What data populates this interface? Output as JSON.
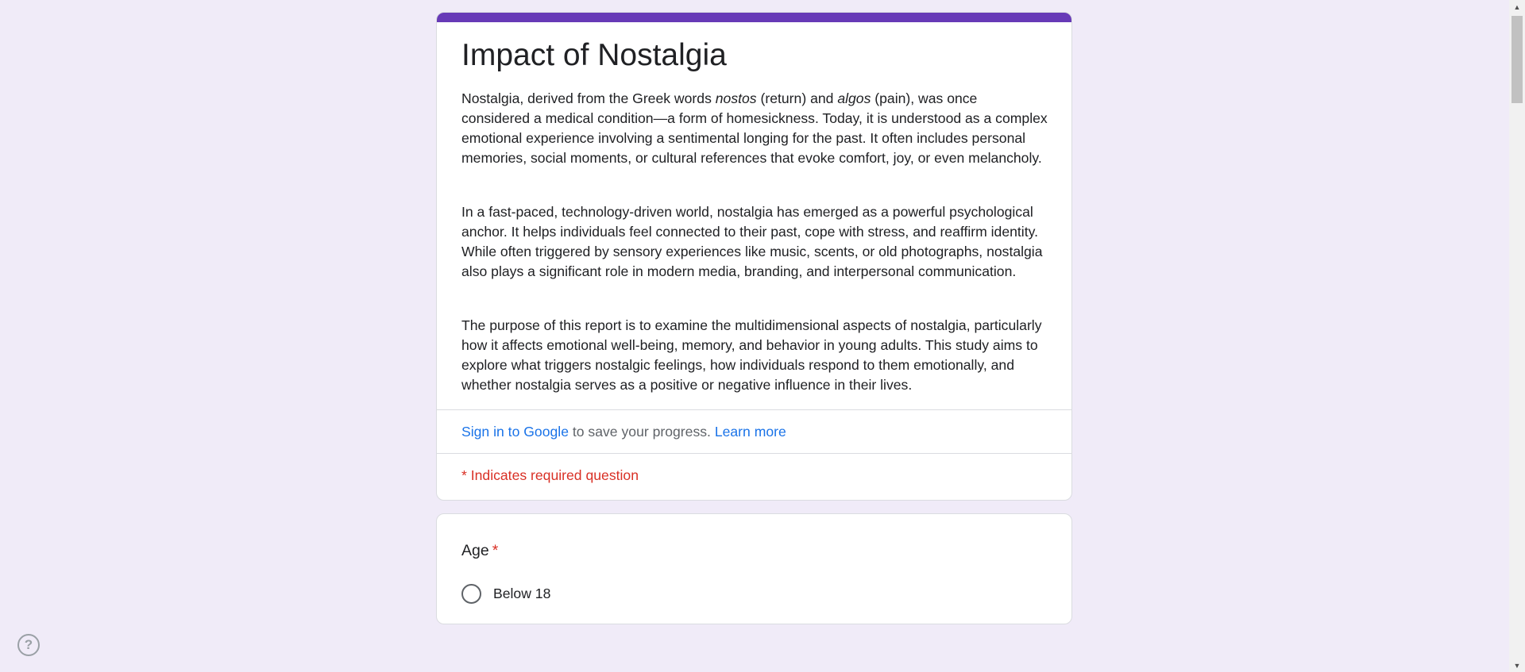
{
  "form": {
    "title": "Impact of Nostalgia",
    "accent_color": "#673ab7",
    "background_color": "#f0ebf8",
    "description": {
      "p1_before_nostos": "Nostalgia, derived from the Greek words ",
      "p1_nostos": "nostos",
      "p1_between": " (return) and ",
      "p1_algos": "algos",
      "p1_after_algos": " (pain), was once considered a medical condition—a form of homesickness. Today, it is understood as a complex emotional experience involving a sentimental longing for the past. It often includes personal memories, social moments, or cultural references that evoke comfort, joy, or even melancholy.",
      "p2": "In a fast-paced, technology-driven world, nostalgia has emerged as a powerful psychological anchor. It helps individuals feel connected to their past, cope with stress, and reaffirm identity. While often triggered by sensory experiences like music, scents, or old photographs, nostalgia also plays a significant role in modern media, branding, and interpersonal communication.",
      "p3": "The purpose of this report is to examine the multidimensional aspects of nostalgia, particularly how it affects emotional well-being, memory, and behavior in young adults. This study aims to explore what triggers nostalgic feelings, how individuals respond to them emotionally, and whether nostalgia serves as a positive or negative influence in their lives."
    },
    "signin": {
      "link_label": "Sign in to Google",
      "text": " to save your progress. ",
      "learn_more_label": "Learn more"
    },
    "required_notice": "* Indicates required question"
  },
  "questions": [
    {
      "title": "Age",
      "required_mark": "*",
      "options": [
        {
          "label": "Below 18",
          "selected": false
        }
      ]
    }
  ],
  "help": {
    "icon": "help-circle-icon",
    "glyph": "?"
  },
  "scrollbar": {
    "up_glyph": "▲",
    "down_glyph": "▼"
  }
}
